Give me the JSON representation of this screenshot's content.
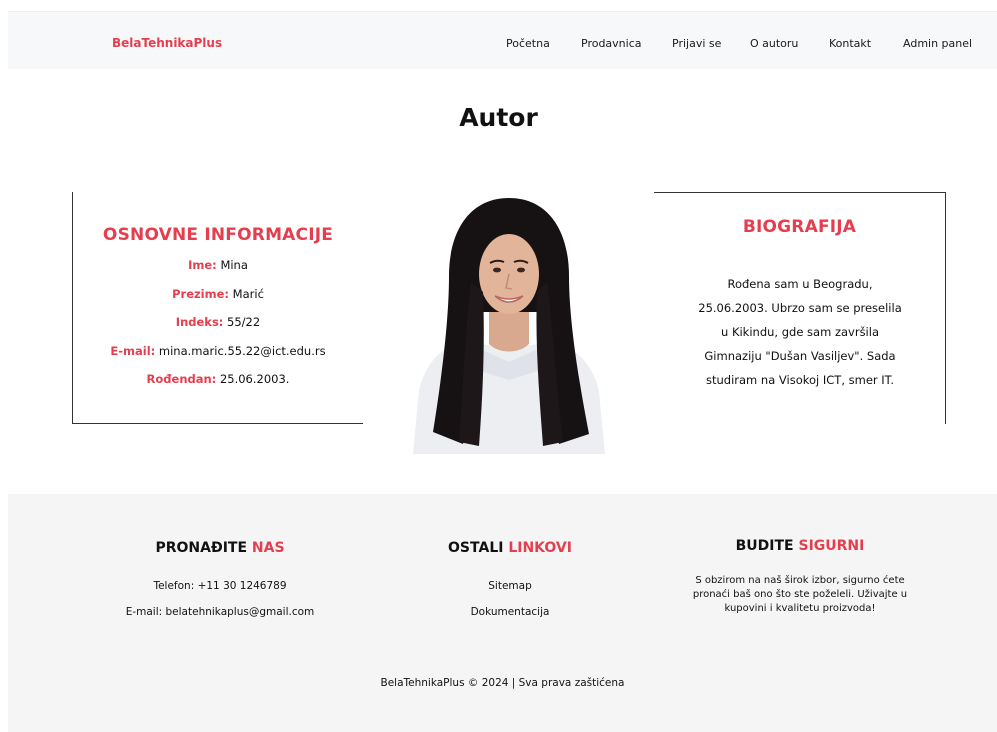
{
  "nav": {
    "brand": "BelaTehnikaPlus",
    "links": [
      "Početna",
      "Prodavnica",
      "Prijavi se",
      "O autoru",
      "Kontakt",
      "Admin panel"
    ]
  },
  "page": {
    "title": "Autor"
  },
  "info": {
    "heading": "OSNOVNE INFORMACIJE",
    "rows": [
      {
        "key": "Ime:",
        "value": "Mina"
      },
      {
        "key": "Prezime:",
        "value": "Marić"
      },
      {
        "key": "Indeks:",
        "value": "55/22"
      },
      {
        "key": "E-mail:",
        "value": "mina.maric.55.22@ict.edu.rs"
      },
      {
        "key": "Rođendan:",
        "value": "25.06.2003."
      }
    ]
  },
  "bio": {
    "heading": "BIOGRAFIJA",
    "text": "Rođena sam u Beogradu, 25.06.2003. Ubrzo sam se preselila u Kikindu, gde sam završila Gimnaziju \"Dušan Vasiljev\". Sada studiram na Visokoj ICT, smer IT."
  },
  "footer": {
    "find": {
      "heading_main": "PRONAĐITE",
      "heading_accent": "NAS",
      "phone": "Telefon: +11 30 1246789",
      "email": "E-mail: belatehnikaplus@gmail.com"
    },
    "links": {
      "heading_main": "OSTALI",
      "heading_accent": "LINKOVI",
      "items": [
        "Sitemap",
        "Dokumentacija"
      ]
    },
    "safe": {
      "heading_main": "BUDITE",
      "heading_accent": "SIGURNI",
      "text": "S obzirom na naš širok izbor, sigurno ćete pronaći baš ono što ste poželeli. Uživajte u kupovini i kvalitetu proizvoda!"
    },
    "copyright": "BelaTehnikaPlus © 2024 | Sva prava zaštićena"
  },
  "colors": {
    "accent": "#e53e4f",
    "nav_bg": "#f7f8f9",
    "footer_bg": "#f5f5f5"
  }
}
